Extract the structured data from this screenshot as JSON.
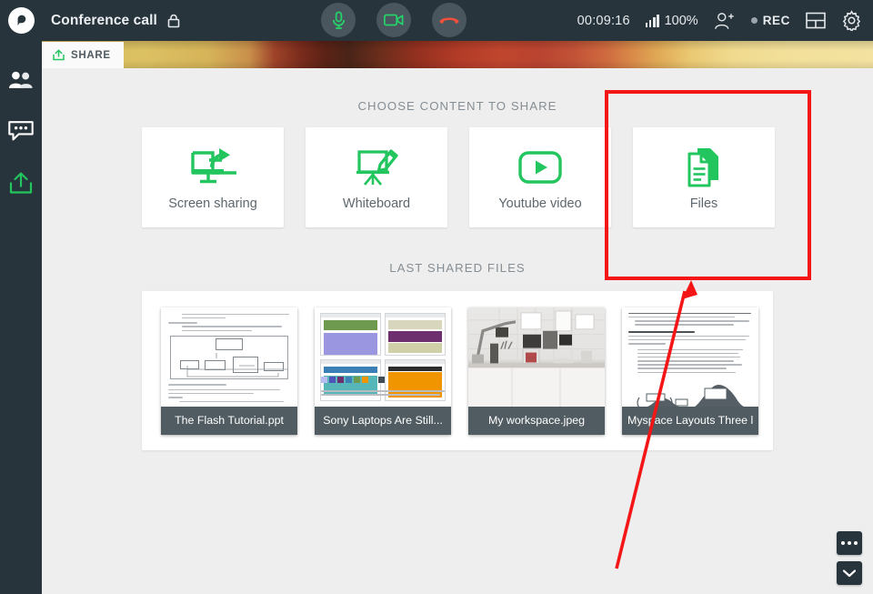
{
  "header": {
    "logo": "proficonf-logo",
    "title": "Conference call",
    "lock_icon": "lock-icon",
    "mic_icon": "microphone-icon",
    "camera_icon": "video-camera-icon",
    "hangup_icon": "hang-up-phone-icon",
    "timer": "00:09:16",
    "signal_icon": "signal-bars-icon",
    "signal_value": "100%",
    "add_participant_icon": "add-user-icon",
    "rec_label": "REC",
    "layout_icon": "layout-grid-icon",
    "settings_icon": "gear-icon"
  },
  "sidebar": {
    "items": [
      {
        "icon": "participants-icon",
        "name": "participants"
      },
      {
        "icon": "chat-bubble-icon",
        "name": "chat"
      },
      {
        "icon": "share-upload-icon",
        "name": "share"
      }
    ]
  },
  "tab": {
    "icon": "share-upload-icon",
    "label": "SHARE"
  },
  "main": {
    "choose_title": "CHOOSE CONTENT TO SHARE",
    "last_shared_title": "LAST SHARED FILES",
    "share_options": [
      {
        "label": "Screen sharing",
        "icon": "screen-share-icon"
      },
      {
        "label": "Whiteboard",
        "icon": "whiteboard-easel-icon"
      },
      {
        "label": "Youtube video",
        "icon": "play-button-icon"
      },
      {
        "label": "Files",
        "icon": "document-file-icon"
      }
    ],
    "files": [
      {
        "name": "The Flash Tutorial.ppt",
        "thumb": "document-uml-diagram"
      },
      {
        "name": "Sony Laptops Are Still...",
        "thumb": "webpage-layout-grid"
      },
      {
        "name": "My workspace.jpeg",
        "thumb": "desk-workspace-photo"
      },
      {
        "name": "Myspace Layouts Three l...",
        "thumb": "text-document-chart"
      }
    ]
  },
  "bottom_controls": [
    {
      "icon": "more-options-icon",
      "name": "more-options"
    },
    {
      "icon": "chevron-down-icon",
      "name": "collapse"
    }
  ],
  "annotations": {
    "highlight_box": "red-highlight-rectangle",
    "arrow": "red-pointer-arrow"
  },
  "colors": {
    "brand_green": "#22c55e",
    "header_dark": "#27343c",
    "annotation_red": "#f41616",
    "hangup_red": "#f0503c",
    "panel_bg": "#eeeeee"
  }
}
